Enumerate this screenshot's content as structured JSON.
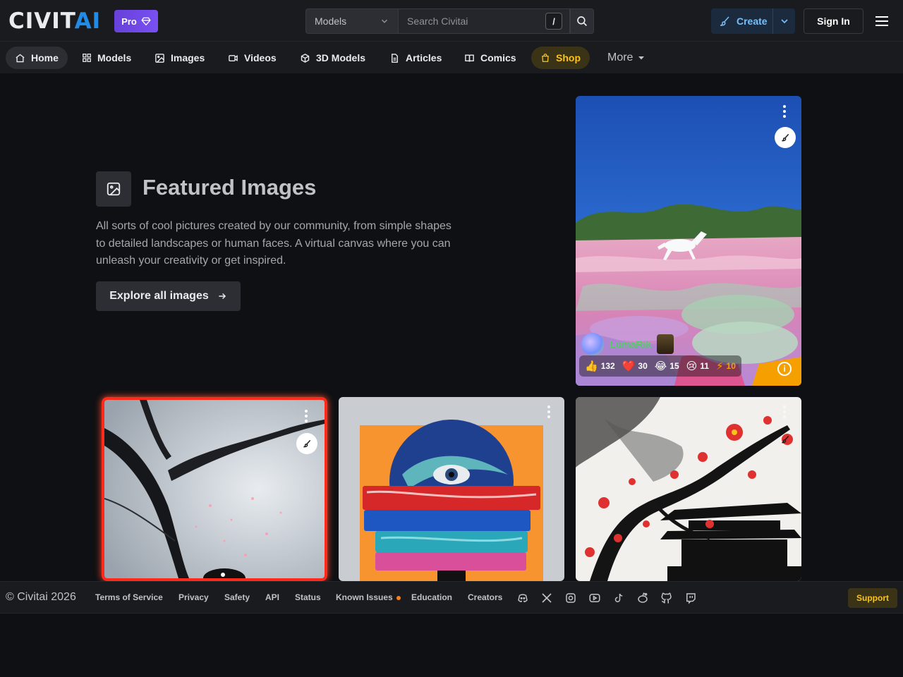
{
  "header": {
    "logo_main": "CIVIT",
    "logo_accent": "AI",
    "pro_label": "Pro",
    "search_category": "Models",
    "search_placeholder": "Search Civitai",
    "search_shortcut": "/",
    "create_label": "Create",
    "signin_label": "Sign In"
  },
  "nav": {
    "items": [
      {
        "label": "Home",
        "icon": "home-icon"
      },
      {
        "label": "Models",
        "icon": "grid-icon"
      },
      {
        "label": "Images",
        "icon": "photo-icon"
      },
      {
        "label": "Videos",
        "icon": "video-icon"
      },
      {
        "label": "3D Models",
        "icon": "cube-icon"
      },
      {
        "label": "Articles",
        "icon": "file-text-icon"
      },
      {
        "label": "Comics",
        "icon": "book-icon"
      },
      {
        "label": "Shop",
        "icon": "shopping-bag-icon"
      }
    ],
    "more_label": "More"
  },
  "featured": {
    "title": "Featured Images",
    "description": "All sorts of cool pictures created by our community, from simple shapes to detailed landscapes or human faces. A virtual canvas where you can unleash your creativity or get inspired.",
    "button_label": "Explore all images"
  },
  "cards": {
    "main": {
      "username": "LumaRik",
      "reactions": [
        {
          "emoji": "👍",
          "count": "132"
        },
        {
          "emoji": "❤️",
          "count": "30"
        },
        {
          "emoji": "😂",
          "count": "15"
        },
        {
          "emoji": "😢",
          "count": "11"
        },
        {
          "emoji": "⚡",
          "count": "10"
        }
      ],
      "info_symbol": "i"
    }
  },
  "footer": {
    "copyright": "© Civitai 2026",
    "links": [
      "Terms of Service",
      "Privacy",
      "Safety",
      "API",
      "Status",
      "Known Issues",
      "Education",
      "Creators"
    ],
    "support_label": "Support",
    "colors": {
      "accent_blue": "#228be6",
      "shop_yellow": "#fcc419",
      "status_orange": "#fd7e14"
    }
  }
}
